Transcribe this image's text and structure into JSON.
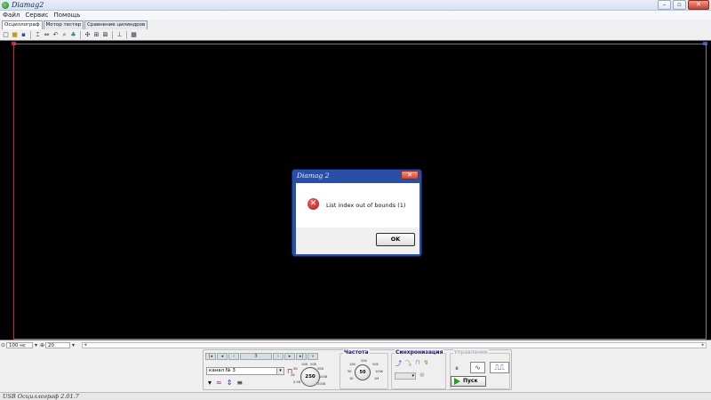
{
  "window": {
    "title": "Diamag2"
  },
  "menu": [
    "Файл",
    "Сервис",
    "Помощь"
  ],
  "tabs": [
    {
      "label": "Осциллограф",
      "active": true
    },
    {
      "label": "Мотор тестер",
      "active": false
    },
    {
      "label": "Сравнение цилиндров",
      "active": false
    }
  ],
  "timebar": {
    "time_value": "100 нс",
    "amp_value": "20"
  },
  "panel": {
    "nav_center": "3",
    "channel": "канал № 3",
    "knob_value": "250",
    "freq_title": "Частота",
    "freq_value": "50",
    "sync_title": "Синхронизация",
    "control_title": "Управление",
    "start_label": "Пуск"
  },
  "dialog": {
    "title": "Diamag 2",
    "message": "List index out of bounds (1)",
    "ok_label": "OK"
  },
  "status": {
    "text": "USB Осциллограф 2.01.7"
  },
  "colors": {
    "scope_bg": "#000000",
    "dialog_frame": "#2a4fa8",
    "error_red": "#b50d0d"
  }
}
